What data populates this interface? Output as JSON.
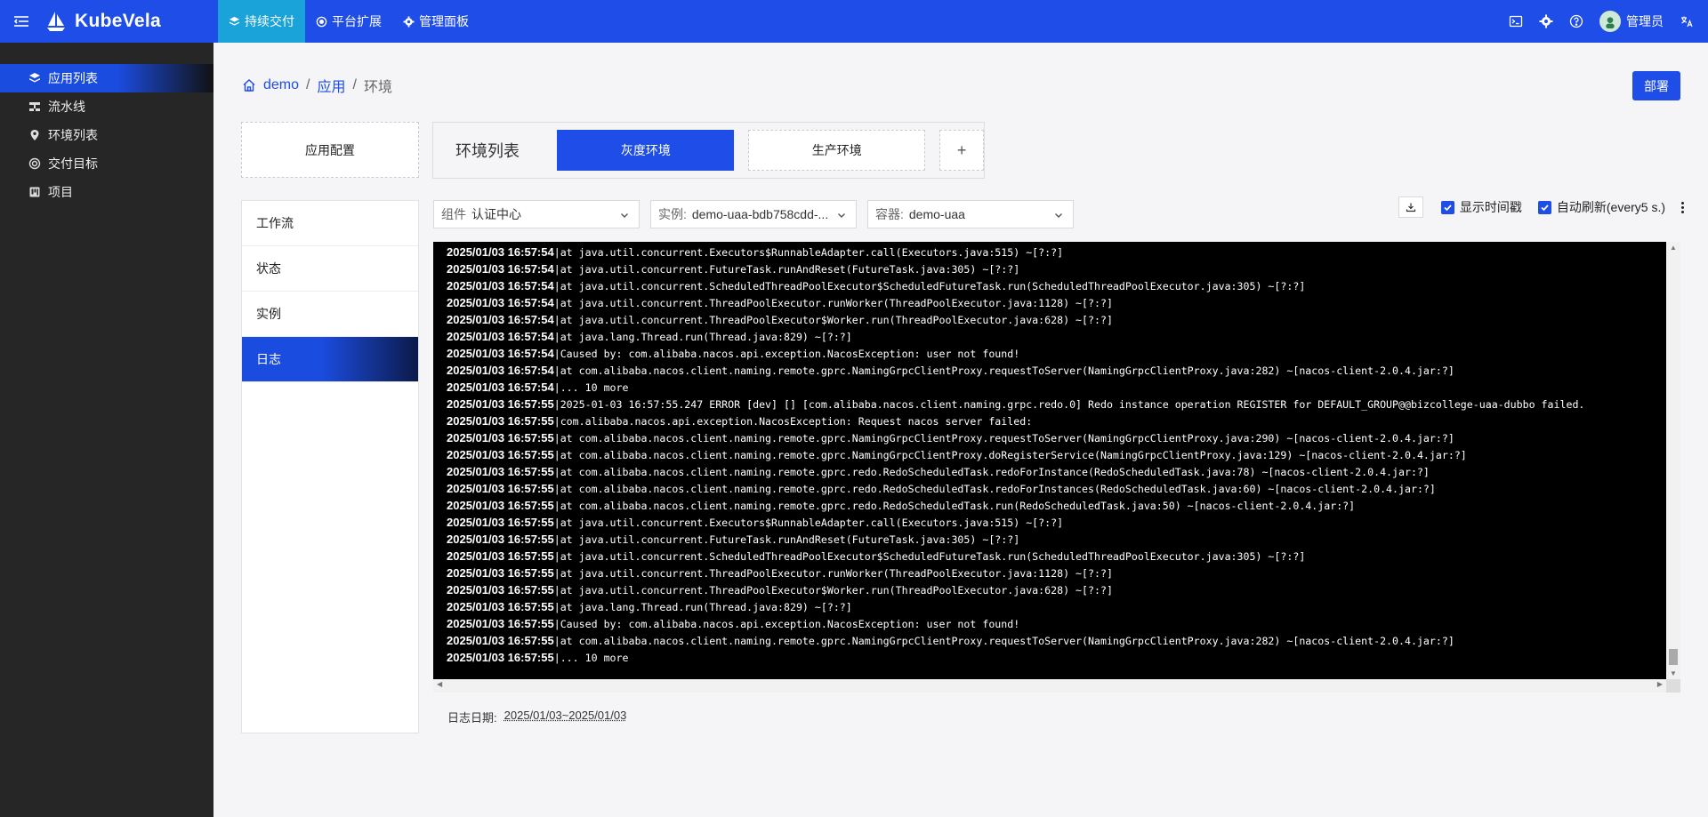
{
  "app": {
    "brand": "KubeVela",
    "topnav": [
      {
        "label": "持续交付",
        "active": true,
        "icon": "layers-icon"
      },
      {
        "label": "平台扩展",
        "active": false,
        "icon": "puzzle-icon"
      },
      {
        "label": "管理面板",
        "active": false,
        "icon": "gear-icon"
      }
    ],
    "user": "管理员",
    "accent": "#1e4de8"
  },
  "sidebar": {
    "items": [
      {
        "label": "应用列表",
        "active": true,
        "icon": "layers-icon"
      },
      {
        "label": "流水线",
        "active": false,
        "icon": "pipeline-icon"
      },
      {
        "label": "环境列表",
        "active": false,
        "icon": "location-icon"
      },
      {
        "label": "交付目标",
        "active": false,
        "icon": "target-icon"
      },
      {
        "label": "项目",
        "active": false,
        "icon": "project-icon"
      }
    ]
  },
  "breadcrumb": [
    "demo",
    "应用",
    "环境"
  ],
  "deploy_label": "部署",
  "app_config_label": "应用配置",
  "env": {
    "title": "环境列表",
    "tabs": [
      "灰度环境",
      "生产环境"
    ],
    "add": "+"
  },
  "menu": [
    "工作流",
    "状态",
    "实例",
    "日志"
  ],
  "filters": {
    "component_label": "组件",
    "component_value": "认证中心",
    "instance_label": "实例:",
    "instance_value": "demo-uaa-bdb758cdd-...",
    "container_label": "容器:",
    "container_value": "demo-uaa"
  },
  "log_tools": {
    "show_timestamp": "显示时间戳",
    "auto_refresh": "自动刷新(every5 s.)"
  },
  "logs": [
    {
      "ts": "2025/01/03 16:57:54",
      "msg": "at java.util.concurrent.Executors$RunnableAdapter.call(Executors.java:515) ~[?:?]"
    },
    {
      "ts": "2025/01/03 16:57:54",
      "msg": "at java.util.concurrent.FutureTask.runAndReset(FutureTask.java:305) ~[?:?]"
    },
    {
      "ts": "2025/01/03 16:57:54",
      "msg": "at java.util.concurrent.ScheduledThreadPoolExecutor$ScheduledFutureTask.run(ScheduledThreadPoolExecutor.java:305) ~[?:?]"
    },
    {
      "ts": "2025/01/03 16:57:54",
      "msg": "at java.util.concurrent.ThreadPoolExecutor.runWorker(ThreadPoolExecutor.java:1128) ~[?:?]"
    },
    {
      "ts": "2025/01/03 16:57:54",
      "msg": "at java.util.concurrent.ThreadPoolExecutor$Worker.run(ThreadPoolExecutor.java:628) ~[?:?]"
    },
    {
      "ts": "2025/01/03 16:57:54",
      "msg": "at java.lang.Thread.run(Thread.java:829) ~[?:?]"
    },
    {
      "ts": "2025/01/03 16:57:54",
      "msg": "Caused by: com.alibaba.nacos.api.exception.NacosException: user not found!"
    },
    {
      "ts": "2025/01/03 16:57:54",
      "msg": "at com.alibaba.nacos.client.naming.remote.gprc.NamingGrpcClientProxy.requestToServer(NamingGrpcClientProxy.java:282) ~[nacos-client-2.0.4.jar:?]"
    },
    {
      "ts": "2025/01/03 16:57:54",
      "msg": "... 10 more"
    },
    {
      "ts": "2025/01/03 16:57:55",
      "msg": "2025-01-03 16:57:55.247 ERROR [dev] [] [com.alibaba.nacos.client.naming.grpc.redo.0] Redo instance operation REGISTER for DEFAULT_GROUP@@bizcollege-uaa-dubbo failed."
    },
    {
      "ts": "2025/01/03 16:57:55",
      "msg": "com.alibaba.nacos.api.exception.NacosException: Request nacos server failed:"
    },
    {
      "ts": "2025/01/03 16:57:55",
      "msg": "at com.alibaba.nacos.client.naming.remote.gprc.NamingGrpcClientProxy.requestToServer(NamingGrpcClientProxy.java:290) ~[nacos-client-2.0.4.jar:?]"
    },
    {
      "ts": "2025/01/03 16:57:55",
      "msg": "at com.alibaba.nacos.client.naming.remote.gprc.NamingGrpcClientProxy.doRegisterService(NamingGrpcClientProxy.java:129) ~[nacos-client-2.0.4.jar:?]"
    },
    {
      "ts": "2025/01/03 16:57:55",
      "msg": "at com.alibaba.nacos.client.naming.remote.gprc.redo.RedoScheduledTask.redoForInstance(RedoScheduledTask.java:78) ~[nacos-client-2.0.4.jar:?]"
    },
    {
      "ts": "2025/01/03 16:57:55",
      "msg": "at com.alibaba.nacos.client.naming.remote.gprc.redo.RedoScheduledTask.redoForInstances(RedoScheduledTask.java:60) ~[nacos-client-2.0.4.jar:?]"
    },
    {
      "ts": "2025/01/03 16:57:55",
      "msg": "at com.alibaba.nacos.client.naming.remote.gprc.redo.RedoScheduledTask.run(RedoScheduledTask.java:50) ~[nacos-client-2.0.4.jar:?]"
    },
    {
      "ts": "2025/01/03 16:57:55",
      "msg": "at java.util.concurrent.Executors$RunnableAdapter.call(Executors.java:515) ~[?:?]"
    },
    {
      "ts": "2025/01/03 16:57:55",
      "msg": "at java.util.concurrent.FutureTask.runAndReset(FutureTask.java:305) ~[?:?]"
    },
    {
      "ts": "2025/01/03 16:57:55",
      "msg": "at java.util.concurrent.ScheduledThreadPoolExecutor$ScheduledFutureTask.run(ScheduledThreadPoolExecutor.java:305) ~[?:?]"
    },
    {
      "ts": "2025/01/03 16:57:55",
      "msg": "at java.util.concurrent.ThreadPoolExecutor.runWorker(ThreadPoolExecutor.java:1128) ~[?:?]"
    },
    {
      "ts": "2025/01/03 16:57:55",
      "msg": "at java.util.concurrent.ThreadPoolExecutor$Worker.run(ThreadPoolExecutor.java:628) ~[?:?]"
    },
    {
      "ts": "2025/01/03 16:57:55",
      "msg": "at java.lang.Thread.run(Thread.java:829) ~[?:?]"
    },
    {
      "ts": "2025/01/03 16:57:55",
      "msg": "Caused by: com.alibaba.nacos.api.exception.NacosException: user not found!"
    },
    {
      "ts": "2025/01/03 16:57:55",
      "msg": "at com.alibaba.nacos.client.naming.remote.gprc.NamingGrpcClientProxy.requestToServer(NamingGrpcClientProxy.java:282) ~[nacos-client-2.0.4.jar:?]"
    },
    {
      "ts": "2025/01/03 16:57:55",
      "msg": "... 10 more"
    }
  ],
  "log_date": {
    "label": "日志日期:",
    "range": "2025/01/03~2025/01/03"
  }
}
